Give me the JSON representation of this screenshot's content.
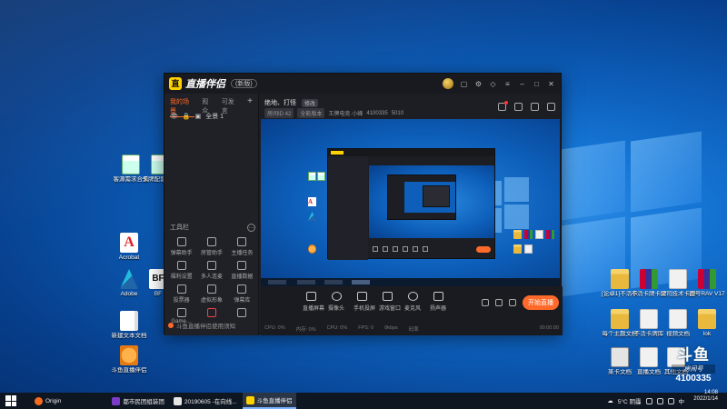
{
  "desktop": {
    "icons_left": [
      {
        "label": "客源需求合集",
        "icon": "spreadsheet-icon"
      },
      {
        "label": "卡牌配套表表",
        "icon": "spreadsheet-icon"
      },
      {
        "label": "Acrobat",
        "icon": "acrobat-icon"
      },
      {
        "label": "Adobe",
        "icon": "adobe-arrow-icon"
      },
      {
        "label": "BF",
        "icon": "bf-icon"
      },
      {
        "label": "新建文本文档",
        "icon": "text-document-icon"
      },
      {
        "label": "斗鱼直播伴侣",
        "icon": "douyu-orange-icon"
      }
    ],
    "icons_right": [
      {
        "label": "[论卓1]不活卡牌",
        "icon": "folder-icon"
      },
      {
        "label": "不活卡牌卡牌",
        "icon": "rar-icon"
      },
      {
        "label": "公司技术卡牌",
        "icon": "file-icon"
      },
      {
        "label": "面号RAV V17",
        "icon": "rar-icon"
      },
      {
        "label": "每个主题文档",
        "icon": "folder-icon"
      },
      {
        "label": "不活卡牌库",
        "icon": "file-icon"
      },
      {
        "label": "视频文档",
        "icon": "file-icon"
      },
      {
        "label": "lok",
        "icon": "folder-icon"
      },
      {
        "label": "某卡文档",
        "icon": "film-icon"
      },
      {
        "label": "直播文档",
        "icon": "file-icon"
      },
      {
        "label": "其他文档",
        "icon": "file-icon"
      }
    ]
  },
  "app": {
    "title": "直播伴侣",
    "badge": "(新版)",
    "sidebar": {
      "tabs": [
        "我的场景",
        "观众",
        "可发言"
      ],
      "add_label": "+",
      "scene_label": "全景 1",
      "tools_title": "工具栏",
      "tools": [
        {
          "label": "弹幕助手",
          "icon": "danmaku-icon"
        },
        {
          "label": "房管助手",
          "icon": "admin-icon"
        },
        {
          "label": "主播任务",
          "icon": "task-icon"
        },
        {
          "label": "福利设置",
          "icon": "gift-icon"
        },
        {
          "label": "多人连麦",
          "icon": "download-icon"
        },
        {
          "label": "直播数据",
          "icon": "data-icon"
        },
        {
          "label": "投票器",
          "icon": "vote-icon"
        },
        {
          "label": "虚拟形象",
          "icon": "download-icon"
        },
        {
          "label": "弹幕库",
          "icon": "library-icon"
        },
        {
          "label": "Game…",
          "icon": "game-icon"
        },
        {
          "label": "",
          "icon": "new-icon"
        },
        {
          "label": "",
          "icon": "download-icon"
        }
      ],
      "footer_text": "斗鱼直播伴侣使用须知"
    },
    "header": {
      "room_title": "绝地、打怪",
      "edit_label": "修改",
      "meta": [
        "房间ID 42",
        "全能版本",
        "王牌电竞·小峰",
        "4100335",
        "5010"
      ]
    },
    "controls": [
      {
        "label": "直播屏幕",
        "icon": "screen-icon"
      },
      {
        "label": "摄像头",
        "icon": "camera-icon"
      },
      {
        "label": "手机投屏",
        "icon": "phone-cast-icon"
      },
      {
        "label": "游戏窗口",
        "icon": "game-window-icon"
      },
      {
        "label": "麦克风",
        "icon": "microphone-icon"
      },
      {
        "label": "扬声器",
        "icon": "speaker-icon"
      }
    ],
    "start_live_label": "开始直播",
    "stats": [
      "CPU: 0%",
      "内存: 0%",
      "CPU: 0%",
      "FPS: 0",
      "0kbps",
      "码率"
    ],
    "timer": "00:00:00"
  },
  "douyu_watermark": {
    "logo": "斗鱼",
    "subtitle": "房间号",
    "room_number": "4100335"
  },
  "taskbar": {
    "items": [
      {
        "label": "Origin",
        "active": false
      },
      {
        "label": "都市民团组装团",
        "active": false
      },
      {
        "label": "20190605 -在向线...",
        "active": false
      },
      {
        "label": "斗鱼直播伴侣",
        "active": true
      }
    ],
    "weather": "5°C 阴霾",
    "ime": "中",
    "time": "14:08",
    "date": "2022/1/14"
  }
}
